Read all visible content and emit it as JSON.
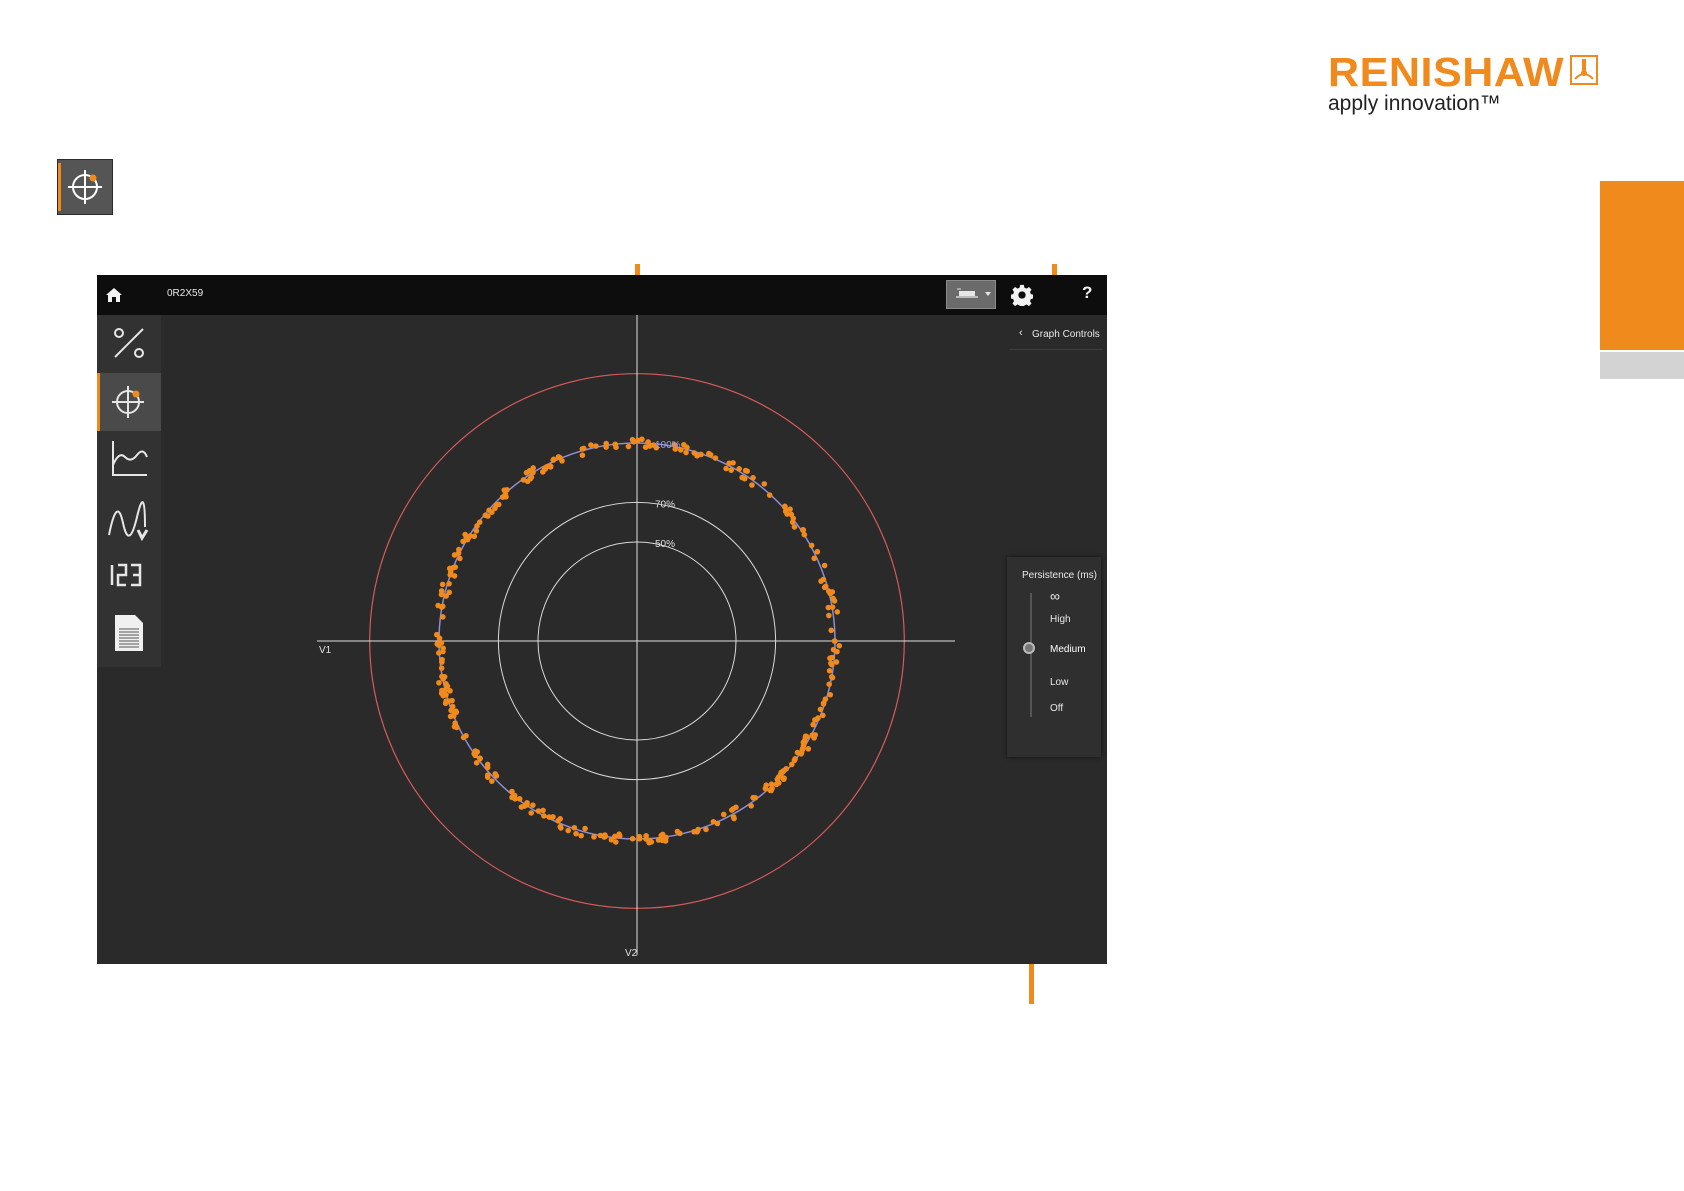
{
  "brand": {
    "name": "RENISHAW",
    "tagline": "apply innovation™",
    "accent_color": "#f08a1c"
  },
  "mode_icon": "lissajous-mode-icon",
  "app": {
    "topbar": {
      "home_icon": "home-icon",
      "device_id": "0R2X59",
      "source_select_icon": "signal-source-icon",
      "settings_icon": "gear-icon",
      "help_label": "?"
    },
    "sidebar": {
      "items": [
        {
          "name": "signal-strength",
          "icon": "percent-icon",
          "active": false
        },
        {
          "name": "lissajous",
          "icon": "crosshair-target-icon",
          "active": true
        },
        {
          "name": "signal-history",
          "icon": "line-graph-icon",
          "active": false
        },
        {
          "name": "waveform",
          "icon": "waveform-icon",
          "active": false
        },
        {
          "name": "numeric",
          "icon": "numeric-123-icon",
          "active": false
        },
        {
          "name": "report",
          "icon": "document-icon",
          "active": false
        }
      ]
    },
    "graph_controls": {
      "chevron": "‹",
      "label": "Graph Controls"
    },
    "persistence": {
      "title": "Persistence (ms)",
      "options": [
        "∞",
        "High",
        "Medium",
        "Low",
        "Off"
      ],
      "selected": "Medium"
    }
  },
  "chart_data": {
    "type": "scatter",
    "title": "",
    "x_axis_label": "V1",
    "y_axis_label": "V2",
    "rings": [
      {
        "label": "100%",
        "percent": 100
      },
      {
        "label": "70%",
        "percent": 70
      },
      {
        "label": "50%",
        "percent": 50
      }
    ],
    "limit_ring_percent": 135,
    "lissajous_radius_percent": 100,
    "ring_color": "#d8d8d8",
    "limit_color": "#d65a5a",
    "trace_color": "#8c8ed8",
    "point_color": "#f08a1c"
  }
}
